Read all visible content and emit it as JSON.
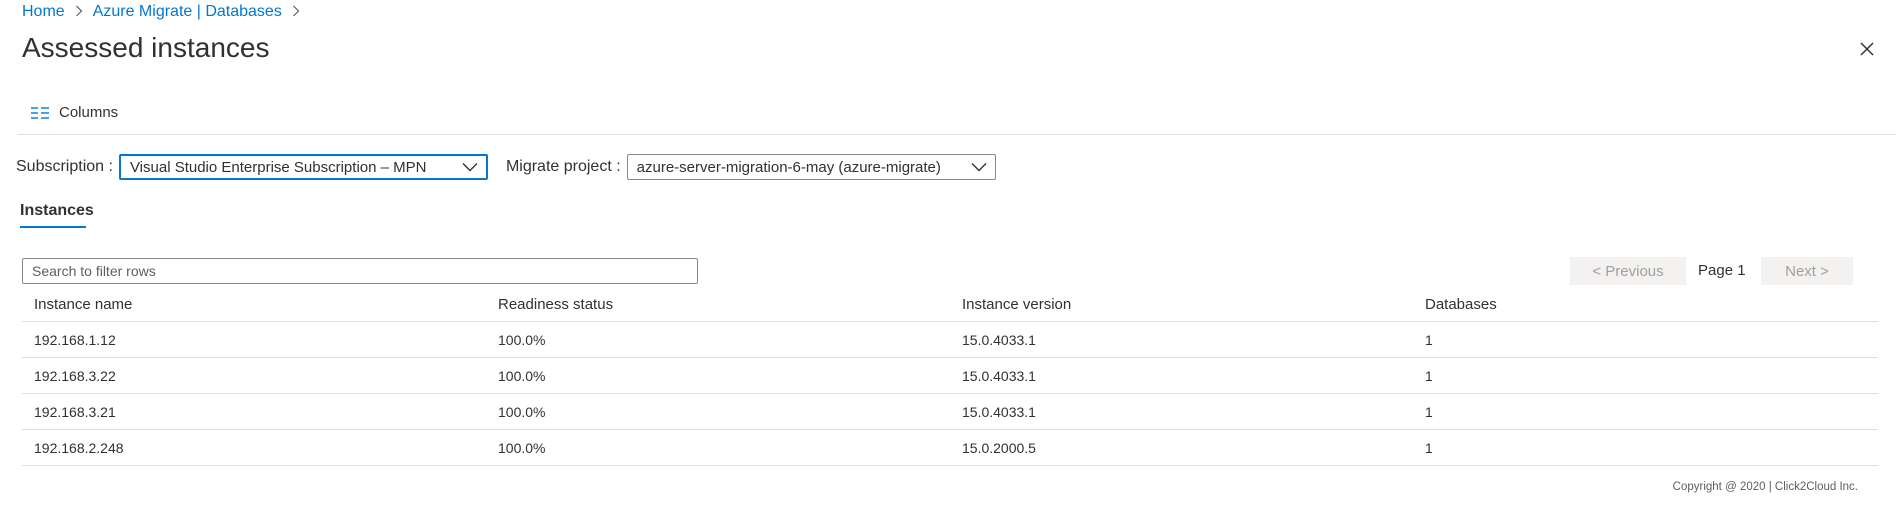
{
  "breadcrumb": {
    "home": "Home",
    "parent": "Azure Migrate | Databases"
  },
  "page": {
    "title": "Assessed instances"
  },
  "toolbar": {
    "columns_label": "Columns"
  },
  "filters": {
    "subscription_label": "Subscription :",
    "subscription_value": "Visual Studio Enterprise Subscription – MPN",
    "project_label": "Migrate project :",
    "project_value": "azure-server-migration-6-may (azure-migrate)"
  },
  "tabs": [
    {
      "label": "Instances",
      "active": true
    }
  ],
  "search": {
    "placeholder": "Search to filter rows"
  },
  "pager": {
    "previous": "< Previous",
    "page": "Page 1",
    "next": "Next >"
  },
  "table": {
    "headers": [
      "Instance name",
      "Readiness status",
      "Instance version",
      "Databases"
    ],
    "rows": [
      [
        "192.168.1.12",
        "100.0%",
        "15.0.4033.1",
        "1"
      ],
      [
        "192.168.3.22",
        "100.0%",
        "15.0.4033.1",
        "1"
      ],
      [
        "192.168.3.21",
        "100.0%",
        "15.0.4033.1",
        "1"
      ],
      [
        "192.168.2.248",
        "100.0%",
        "15.0.2000.5",
        "1"
      ]
    ]
  },
  "footer": {
    "copyright": "Copyright @ 2020  |   Click2Cloud Inc."
  },
  "colors": {
    "accent": "#0078d4",
    "text": "#323130",
    "border": "#e1dfdd"
  }
}
